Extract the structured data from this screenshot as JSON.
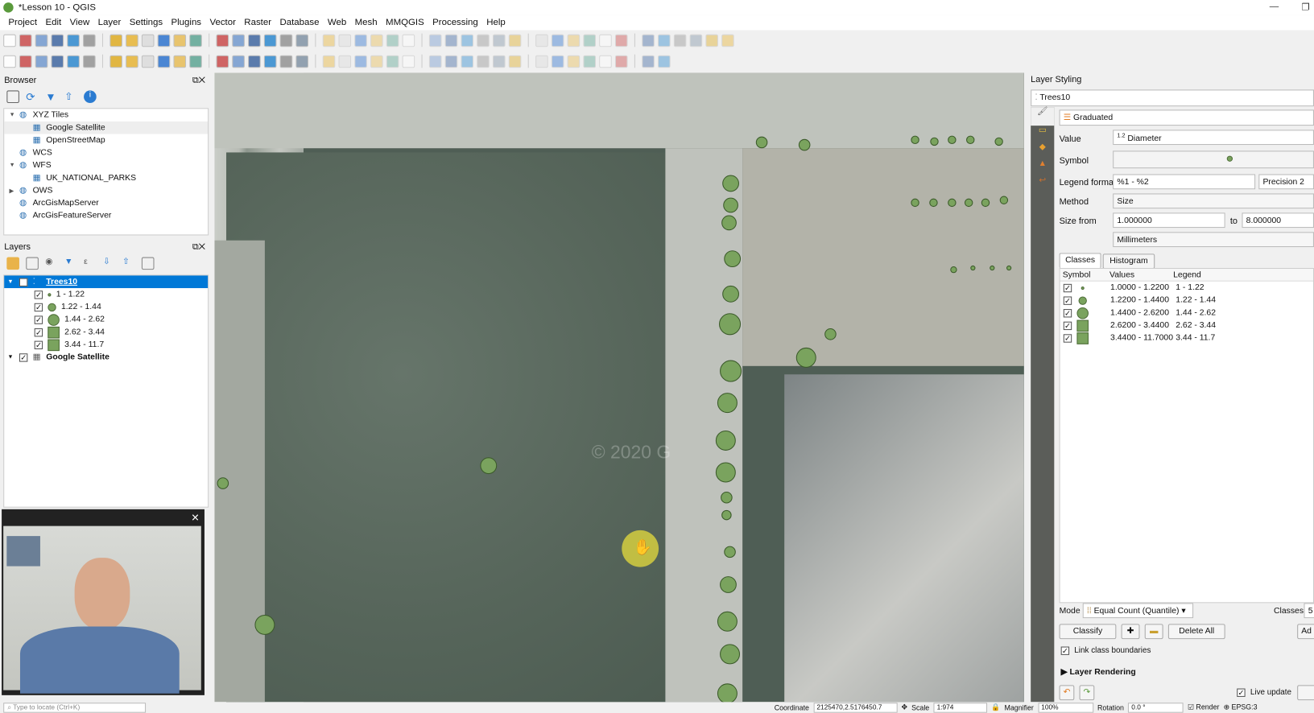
{
  "window": {
    "title": "*Lesson 10 - QGIS"
  },
  "menu": [
    "Project",
    "Edit",
    "View",
    "Layer",
    "Settings",
    "Plugins",
    "Vector",
    "Raster",
    "Database",
    "Web",
    "Mesh",
    "MMQGIS",
    "Processing",
    "Help"
  ],
  "browser": {
    "title": "Browser",
    "items": [
      {
        "label": "XYZ Tiles",
        "level": 0,
        "expanded": true
      },
      {
        "label": "Google Satellite",
        "level": 1
      },
      {
        "label": "OpenStreetMap",
        "level": 1
      },
      {
        "label": "WCS",
        "level": 0
      },
      {
        "label": "WFS",
        "level": 0,
        "expanded": true
      },
      {
        "label": "UK_NATIONAL_PARKS",
        "level": 1
      },
      {
        "label": "OWS",
        "level": 0
      },
      {
        "label": "ArcGisMapServer",
        "level": 0
      },
      {
        "label": "ArcGisFeatureServer",
        "level": 0
      }
    ]
  },
  "layers": {
    "title": "Layers",
    "items": [
      {
        "label": "Trees10",
        "selected": true
      },
      {
        "label": "1 - 1.22",
        "sub": true
      },
      {
        "label": "1.22 - 1.44",
        "sub": true
      },
      {
        "label": "1.44 - 2.62",
        "sub": true
      },
      {
        "label": "2.62 - 3.44",
        "sub": true
      },
      {
        "label": "3.44 - 11.7",
        "sub": true
      },
      {
        "label": "Google Satellite"
      }
    ]
  },
  "styling": {
    "title": "Layer Styling",
    "layer": "Trees10",
    "renderer": "Graduated",
    "value_label": "Value",
    "value": "Diameter",
    "value_prefix": "1.2",
    "symbol_label": "Symbol",
    "legend_format_label": "Legend format",
    "legend_format": "%1 - %2",
    "precision": "Precision 2",
    "method_label": "Method",
    "method": "Size",
    "size_from_label": "Size from",
    "size_from": "1.000000",
    "to_label": "to",
    "size_to": "8.000000",
    "unit": "Millimeters",
    "tabs": [
      "Classes",
      "Histogram"
    ],
    "columns": [
      "Symbol",
      "Values",
      "Legend"
    ],
    "classes": [
      {
        "values": "1.0000 - 1.2200",
        "legend": "1 - 1.22"
      },
      {
        "values": "1.2200 - 1.4400",
        "legend": "1.22 - 1.44"
      },
      {
        "values": "1.4400 - 2.6200",
        "legend": "1.44 - 2.62"
      },
      {
        "values": "2.6200 - 3.4400",
        "legend": "2.62 - 3.44"
      },
      {
        "values": "3.4400 - 11.7000",
        "legend": "3.44 - 11.7"
      }
    ],
    "mode_label": "Mode",
    "mode": "Equal Count (Quantile)",
    "classes_label": "Classes",
    "classes_count": "5",
    "classify": "Classify",
    "delete_all": "Delete All",
    "add": "Ad",
    "link_boundaries": "Link class boundaries",
    "layer_rendering": "Layer Rendering",
    "live_update": "Live update"
  },
  "status": {
    "locate_placeholder": "Type to locate (Ctrl+K)",
    "coordinate_label": "Coordinate",
    "coordinate": "2125470,2.5176450.7",
    "scale_label": "Scale",
    "scale": "1:974",
    "magnifier_label": "Magnifier",
    "magnifier": "100%",
    "rotation_label": "Rotation",
    "rotation": "0.0 °",
    "render": "Render",
    "crs": "EPSG:3"
  },
  "map": {
    "watermark": "© 2020 G"
  },
  "colors": {
    "accent": "#0078d7",
    "symbol": "#7aa35e"
  }
}
